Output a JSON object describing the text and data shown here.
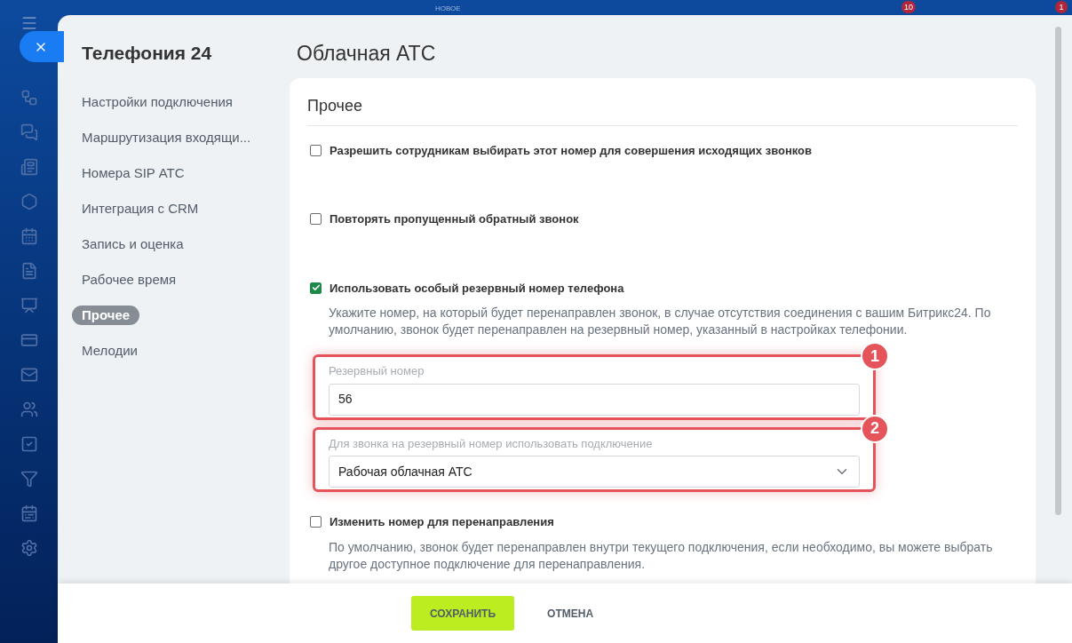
{
  "background": {
    "label": "НОВОЕ",
    "badges": [
      "10",
      "1"
    ]
  },
  "nav": {
    "title": "Телефония 24",
    "items": [
      {
        "label": "Настройки подключения",
        "selected": false
      },
      {
        "label": "Маршрутизация входящи...",
        "selected": false
      },
      {
        "label": "Номера SIP АТС",
        "selected": false
      },
      {
        "label": "Интеграция с CRM",
        "selected": false
      },
      {
        "label": "Запись и оценка",
        "selected": false
      },
      {
        "label": "Рабочее время",
        "selected": false
      },
      {
        "label": "Прочее",
        "selected": true
      },
      {
        "label": "Мелодии",
        "selected": false
      }
    ]
  },
  "page_title": "Облачная АТС",
  "section": {
    "title": "Прочее",
    "options": [
      {
        "label": "Разрешить сотрудникам выбирать этот номер для совершения исходящих звонков",
        "checked": false
      },
      {
        "label": "Повторять пропущенный обратный звонок",
        "checked": false
      },
      {
        "label": "Использовать особый резервный номер телефона",
        "checked": true,
        "description": "Укажите номер, на который будет перенаправлен звонок, в случае отсутствия соединения с вашим Битрикс24. По умолчанию, звонок будет перенаправлен на резервный номер, указанный в настройках телефонии.",
        "fields": [
          {
            "kind": "input",
            "label": "Резервный номер",
            "value": "56",
            "marker": "1"
          },
          {
            "kind": "select",
            "label": "Для звонка на резервный номер использовать подключение",
            "value": "Рабочая облачная АТС",
            "marker": "2"
          }
        ]
      },
      {
        "label": "Изменить номер для перенаправления",
        "checked": false,
        "description": "По умолчанию, звонок будет перенаправлен внутри текущего подключения, если необходимо, вы можете выбрать другое доступное подключение для перенаправления."
      }
    ]
  },
  "footer": {
    "buttons": [
      {
        "label": "СОХРАНИТЬ",
        "kind": "primary"
      },
      {
        "label": "ОТМЕНА",
        "kind": "link"
      }
    ]
  }
}
